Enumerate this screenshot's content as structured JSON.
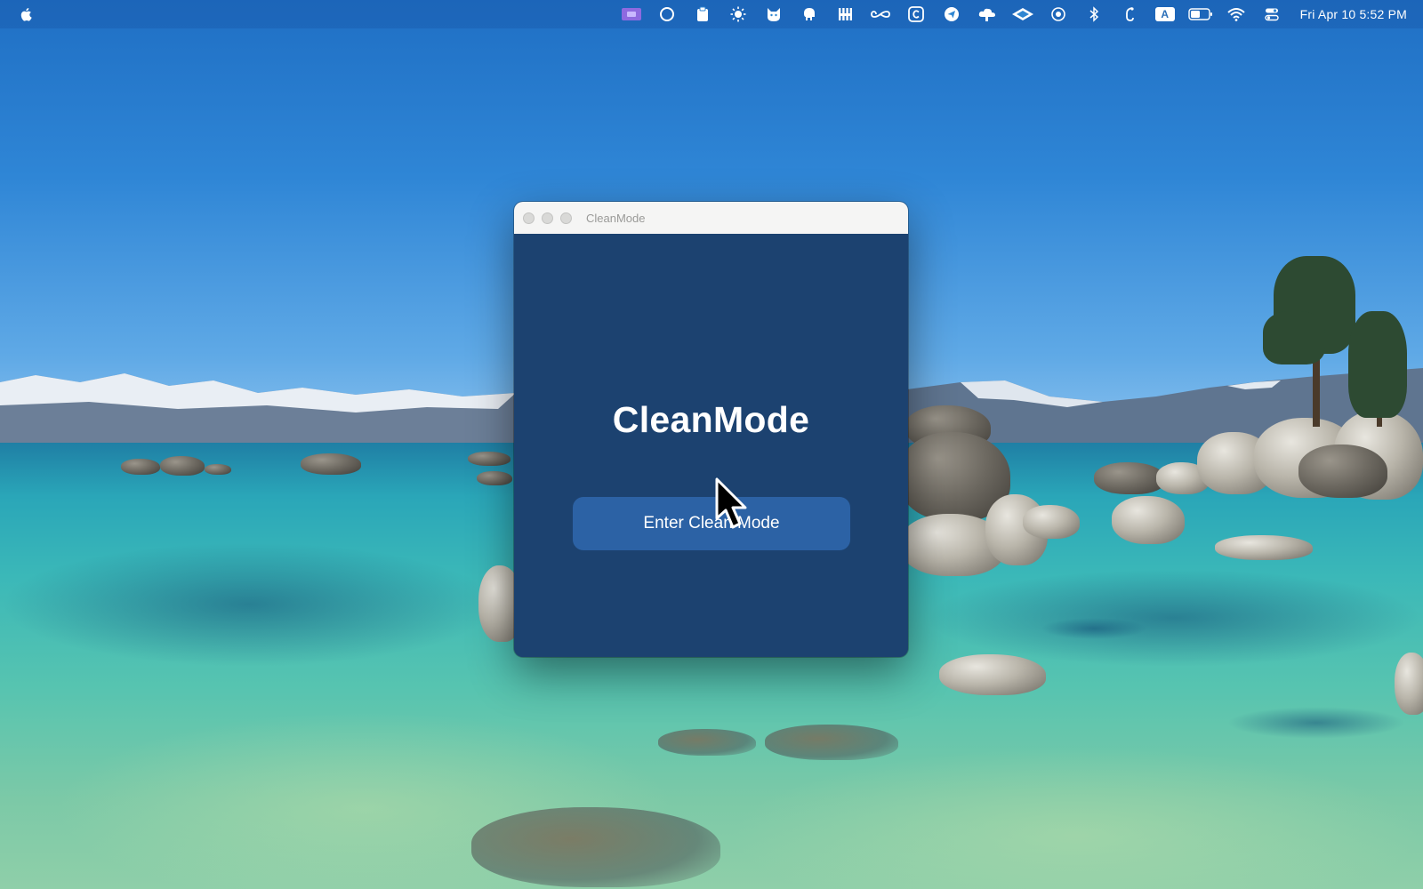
{
  "menubar": {
    "status_icons": [
      "screen-share-icon",
      "circle-icon",
      "clipboard-icon",
      "sun-icon",
      "cat-icon",
      "elephant-icon",
      "fork-icon",
      "infinity-icon",
      "copyright-icon",
      "paper-plane-icon",
      "cloud-icon",
      "diamond-icon",
      "record-icon",
      "bluetooth-icon",
      "hook-icon",
      "keyboard-input-icon",
      "battery-icon",
      "wifi-icon",
      "control-center-icon"
    ],
    "input_badge": "A",
    "clock": "Fri Apr 10  5:52 PM"
  },
  "window": {
    "title": "CleanMode",
    "heading": "CleanMode",
    "button_label": "Enter Clean Mode"
  },
  "colors": {
    "window_body": "#1c4270",
    "button": "#2c62a5",
    "titlebar": "#f5f5f4"
  }
}
